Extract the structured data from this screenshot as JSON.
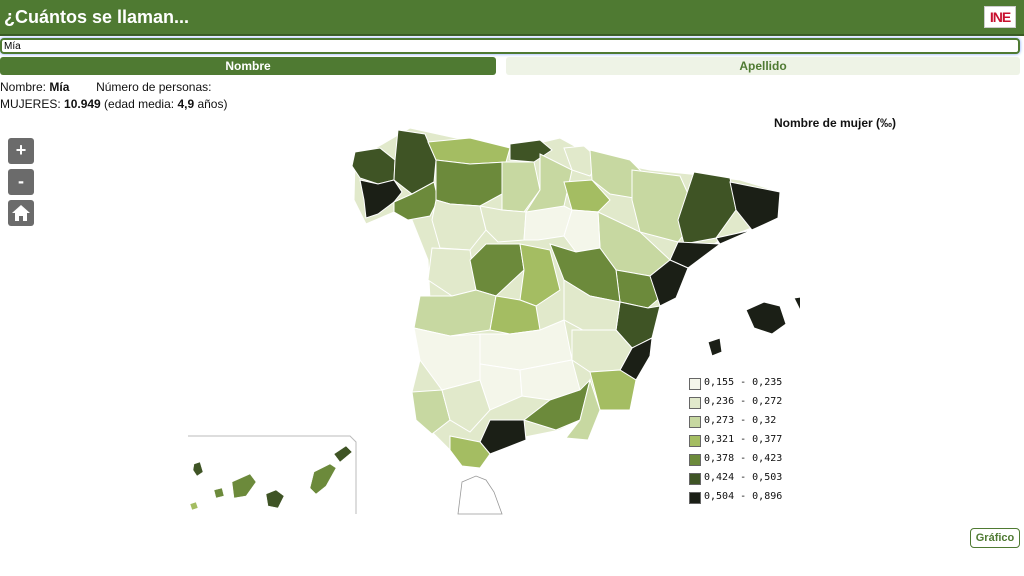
{
  "header": {
    "title": "¿Cuántos se llaman...",
    "logo_text": "INE"
  },
  "search": {
    "value": "Mía"
  },
  "tabs": [
    {
      "label": "Nombre",
      "active": true
    },
    {
      "label": "Apellido",
      "active": false
    }
  ],
  "info": {
    "nombre_label": "Nombre: ",
    "nombre_value": "Mía",
    "personas_label": "Número de personas:",
    "mujeres_label": "MUJERES: ",
    "mujeres_value": "10.949",
    "edad_label": " (edad media: ",
    "edad_value": "4,9",
    "edad_suffix": " años)"
  },
  "zoom": {
    "in": "+",
    "out": "-",
    "home_icon": "home-icon"
  },
  "legend": {
    "title": "Nombre de mujer (‰)",
    "items": [
      {
        "label": "0,155 - 0,235",
        "color": "#f4f6ea"
      },
      {
        "label": "0,236 - 0,272",
        "color": "#e1e9cb"
      },
      {
        "label": "0,273 - 0,32",
        "color": "#c7d8a1"
      },
      {
        "label": "0,321 - 0,377",
        "color": "#a4bd62"
      },
      {
        "label": "0,378 - 0,423",
        "color": "#6c8a3b"
      },
      {
        "label": "0,424 - 0,503",
        "color": "#3f5425"
      },
      {
        "label": "0,504 - 0,896",
        "color": "#1b1f16"
      }
    ]
  },
  "grafico_label": "Gráfico"
}
